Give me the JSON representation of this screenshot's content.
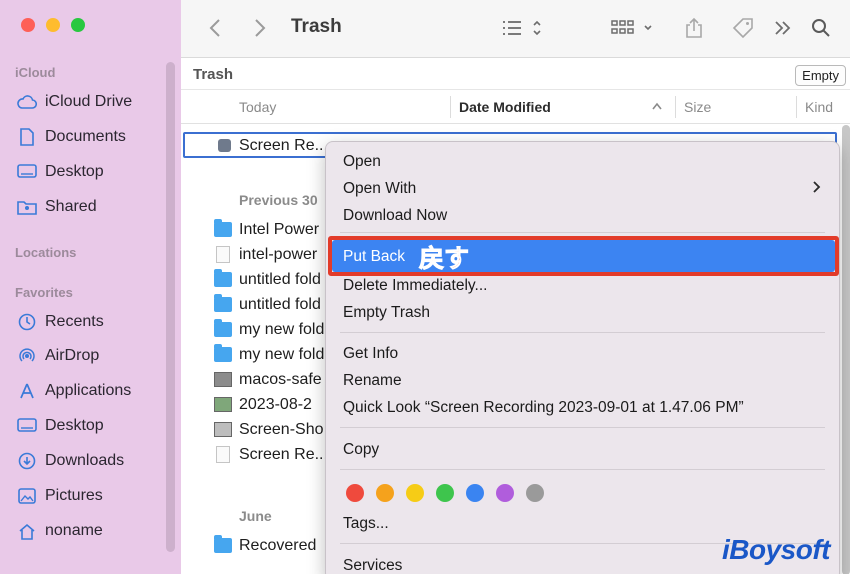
{
  "window": {
    "title": "Trash",
    "path_title": "Trash",
    "empty_button": "Empty"
  },
  "toolbar": {
    "icons": [
      "chevron-left-icon",
      "chevron-right-icon",
      "list-view-icon",
      "group-icon",
      "share-icon",
      "tag-icon",
      "more-icon",
      "search-icon"
    ]
  },
  "sidebar": {
    "icloud_header": "iCloud",
    "icloud_items": [
      {
        "label": "iCloud Drive",
        "icon": "cloud-icon"
      },
      {
        "label": "Documents",
        "icon": "document-icon"
      },
      {
        "label": "Desktop",
        "icon": "desktop-icon"
      },
      {
        "label": "Shared",
        "icon": "shared-folder-icon"
      }
    ],
    "locations_header": "Locations",
    "favorites_header": "Favorites",
    "favorites_items": [
      {
        "label": "Recents",
        "icon": "clock-icon"
      },
      {
        "label": "AirDrop",
        "icon": "airdrop-icon"
      },
      {
        "label": "Applications",
        "icon": "applications-icon"
      },
      {
        "label": "Desktop",
        "icon": "desktop-icon"
      },
      {
        "label": "Downloads",
        "icon": "download-icon"
      },
      {
        "label": "Pictures",
        "icon": "pictures-icon"
      },
      {
        "label": "noname",
        "icon": "home-icon"
      }
    ]
  },
  "columns": {
    "name": "Today",
    "date": "Date Modified",
    "size": "Size",
    "kind": "Kind"
  },
  "files": {
    "selected": "Screen Re...",
    "group_previous": "Previous 30",
    "previous": [
      {
        "name": "Intel Power",
        "icon": "folder-icon"
      },
      {
        "name": "intel-power",
        "icon": "document-icon"
      },
      {
        "name": "untitled fold",
        "icon": "folder-icon"
      },
      {
        "name": "untitled fold",
        "icon": "folder-icon"
      },
      {
        "name": "my new fold",
        "icon": "folder-icon"
      },
      {
        "name": "my new fold",
        "icon": "folder-icon"
      },
      {
        "name": "macos-safe",
        "icon": "image-icon"
      },
      {
        "name": "2023-08-2",
        "icon": "image-icon"
      },
      {
        "name": "Screen-Sho",
        "icon": "image-icon"
      },
      {
        "name": "Screen Re...",
        "icon": "document-icon"
      }
    ],
    "group_june": "June",
    "june": [
      {
        "name": "Recovered",
        "icon": "folder-icon"
      }
    ]
  },
  "context_menu": {
    "open": "Open",
    "open_with": "Open With",
    "download_now": "Download Now",
    "put_back": "Put Back",
    "put_back_annotation": "戻す",
    "delete_immediately": "Delete Immediately...",
    "empty_trash": "Empty Trash",
    "get_info": "Get Info",
    "rename": "Rename",
    "quick_look": "Quick Look “Screen Recording 2023-09-01 at 1.47.06 PM”",
    "copy": "Copy",
    "tags": "Tags...",
    "services": "Services",
    "tag_colors": [
      "#ef4a3d",
      "#f5a21c",
      "#f6cc16",
      "#3ec54d",
      "#3a84f1",
      "#b05ddc",
      "#9a9a9a"
    ]
  },
  "watermark": "iBoysoft"
}
